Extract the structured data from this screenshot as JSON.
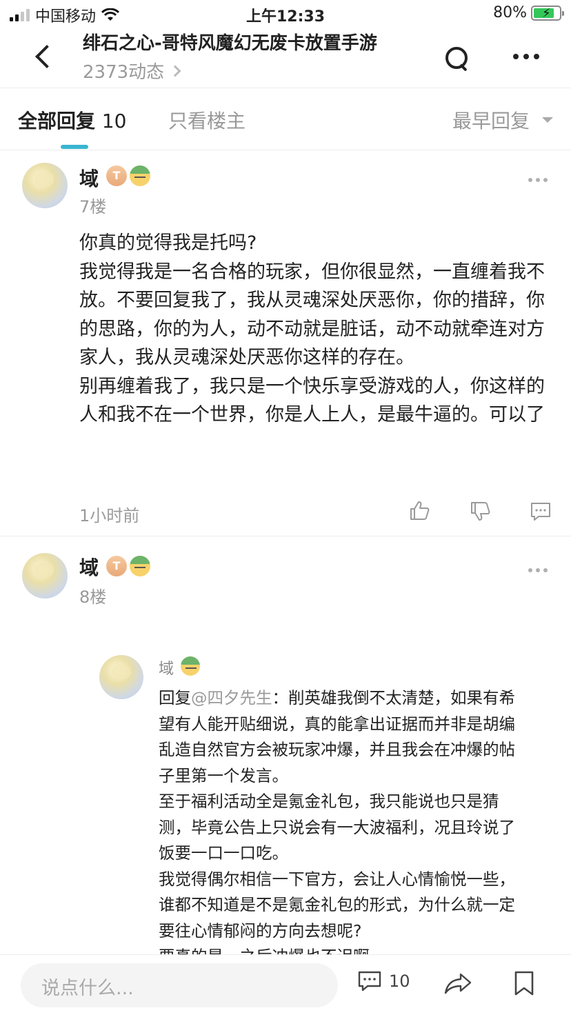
{
  "status_bar": {
    "carrier": "中国移动",
    "time": "上午12:33",
    "battery": "80%"
  },
  "header": {
    "title": "绯石之心-哥特风魔幻无废卡放置手游",
    "subtitle": "2373动态"
  },
  "tabs": {
    "all_label": "全部回复",
    "all_count": "10",
    "owner_only": "只看楼主",
    "sort_label": "最早回复"
  },
  "posts": [
    {
      "username": "域",
      "badge_level": "T",
      "floor": "7楼",
      "text": "你真的觉得我是托吗?\n我觉得我是一名合格的玩家，但你很显然，一直缠着我不放。不要回复我了，我从灵魂深处厌恶你，你的措辞，你的思路，你的为人，动不动就是脏话，动不动就牵连对方家人，我从灵魂深处厌恶你这样的存在。\n别再缠着我了，我只是一个快乐享受游戏的人，你这样的人和我不在一个世界，你是人上人，是最牛逼的。可以了",
      "time": "1小时前"
    },
    {
      "username": "域",
      "badge_level": "T",
      "floor": "8楼",
      "nested": {
        "username": "域",
        "reply_prefix": "回复",
        "mention": "@四夕先生",
        "text": "：削英雄我倒不太清楚，如果有希望有人能开贴细说，真的能拿出证据而并非是胡编乱造自然官方会被玩家冲爆，并且我会在冲爆的帖子里第一个发言。\n至于福利活动全是氪金礼包，我只能说也只是猜测，毕竟公告上只说会有一大波福利，况且玲说了饭要一口一口吃。\n我觉得偶尔相信一下官方，会让人心情愉悦一些，谁都不知道是不是氪金礼包的形式，为什么就一定要往心情郁闷的方向去想呢?\n要真的是，之后冲爆也不迟啊"
      }
    }
  ],
  "bottom_bar": {
    "input_placeholder": "说点什么...",
    "comment_count": "10"
  },
  "icons": {
    "back": "back-arrow-icon",
    "search": "search-icon",
    "more": "more-icon",
    "like": "thumbs-up-icon",
    "dislike": "thumbs-down-icon",
    "reply": "comment-icon",
    "share": "share-icon",
    "bookmark": "bookmark-icon"
  },
  "colors": {
    "accent": "#3ab5d0",
    "muted": "#999999"
  }
}
